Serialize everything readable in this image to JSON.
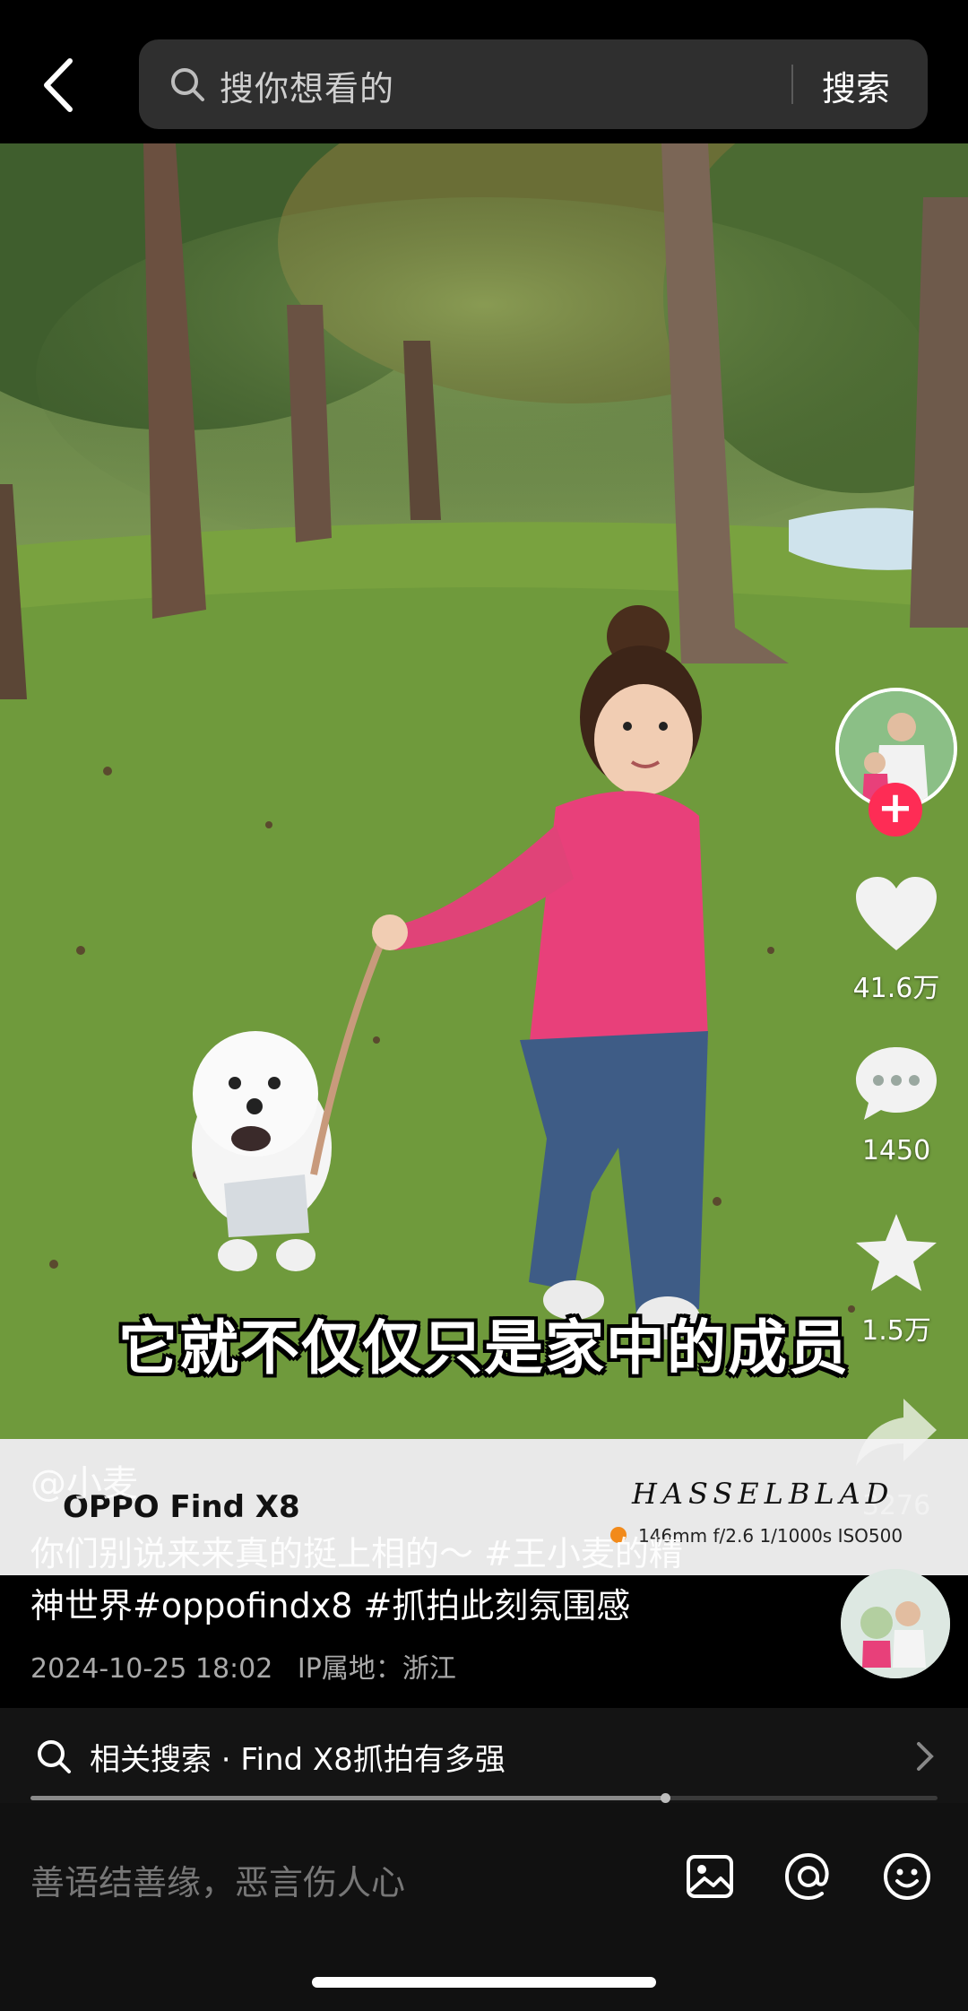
{
  "search": {
    "placeholder": "搜你想看的",
    "button_label": "搜索"
  },
  "video": {
    "subtitle": "它就不仅仅只是家中的成员"
  },
  "rail": {
    "like_count": "41.6万",
    "comment_count": "1450",
    "favorite_count": "1.5万",
    "share_count": "3276"
  },
  "watermark": {
    "model": "OPPO Find X8",
    "brand": "HASSELBLAD",
    "params": "146mm f/2.6 1/1000s ISO500"
  },
  "post": {
    "author": "@小麦",
    "description_line1": "你们别说来来真的挺上相的～ #王小麦的精",
    "description_line2": "神世界#oppofindx8 #抓拍此刻氛围感",
    "date": "2024-10-25 18:02",
    "ip_location": "IP属地：浙江"
  },
  "related": {
    "text": "相关搜索 · Find X8抓拍有多强"
  },
  "progress": {
    "fraction": 0.7
  },
  "comment": {
    "placeholder": "善语结善缘，恶言伤人心"
  },
  "colors": {
    "follow": "#fe2c55",
    "background": "#000000",
    "grass": "#6f9a3c",
    "sweater": "#e8407a"
  }
}
